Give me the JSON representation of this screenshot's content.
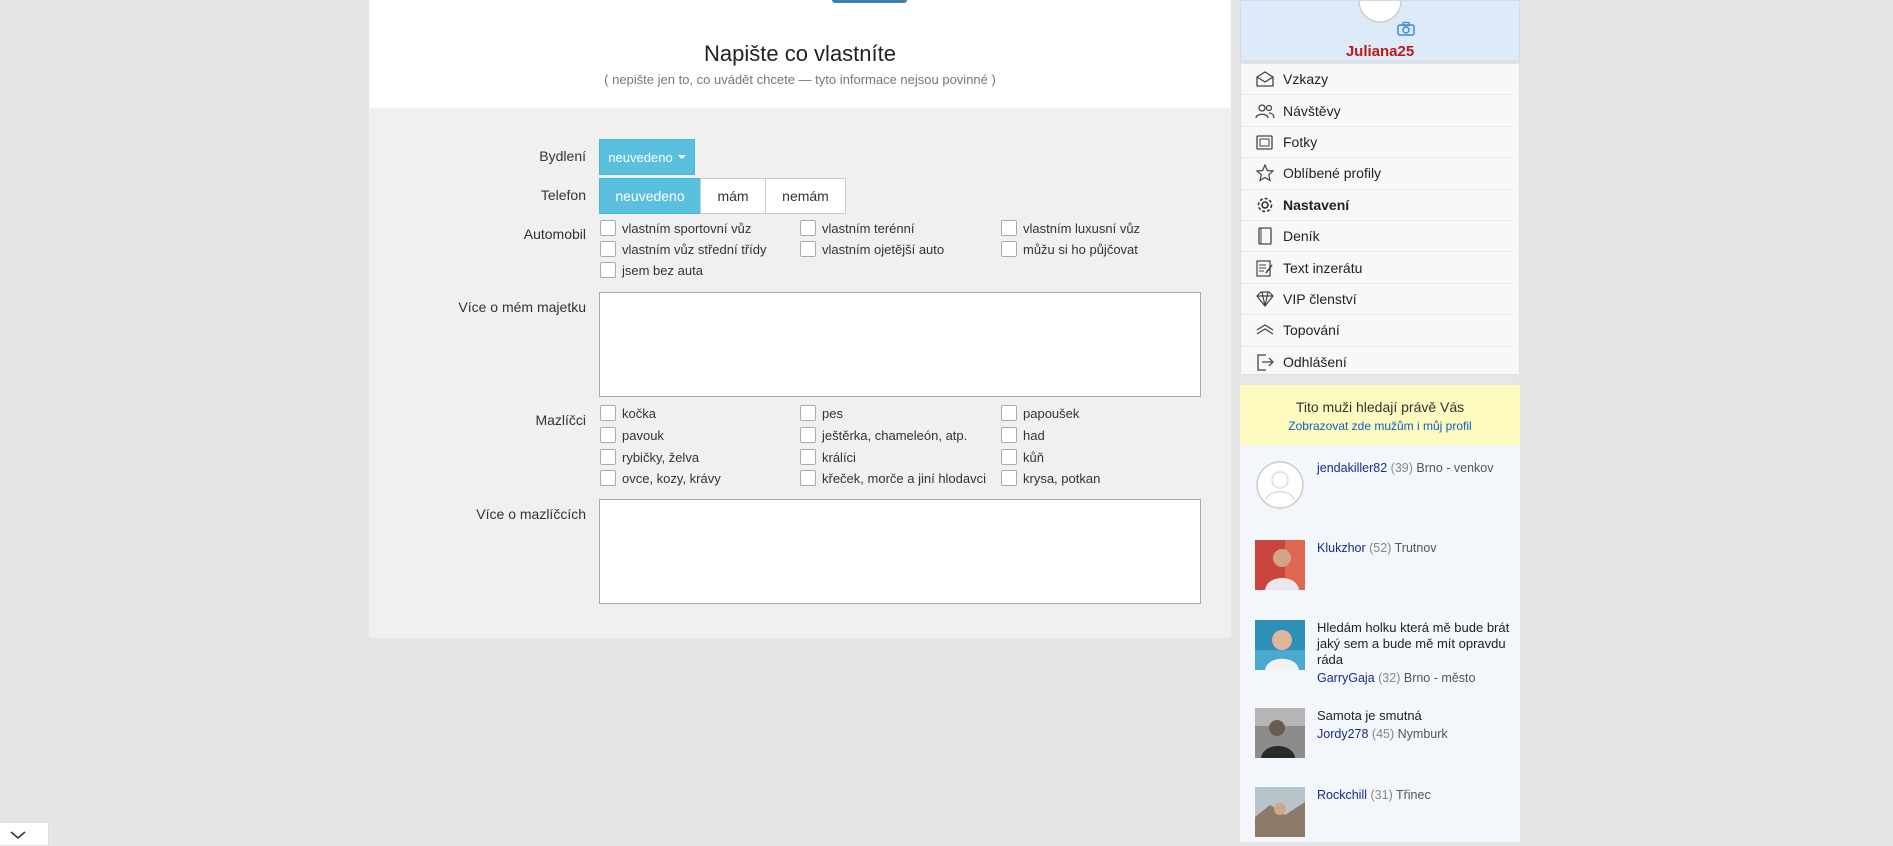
{
  "main": {
    "title": "Napište co vlastníte",
    "subtitle": "( nepište jen to, co uvádět chcete — tyto informace nejsou povinné )",
    "bydleni": {
      "label": "Bydlení",
      "value": "neuvedeno"
    },
    "telefon": {
      "label": "Telefon",
      "options": [
        "neuvedeno",
        "mám",
        "nemám"
      ]
    },
    "automobil": {
      "label": "Automobil",
      "options": [
        "vlastním sportovní vůz",
        "vlastním terénní",
        "vlastním luxusní vůz",
        "vlastním vůz střední třídy",
        "vlastním ojetější auto",
        "můžu si ho půjčovat",
        "jsem bez auta"
      ]
    },
    "majetek": {
      "label": "Více o mém majetku"
    },
    "mazlicci": {
      "label": "Mazlíčci",
      "options": [
        "kočka",
        "pes",
        "papoušek",
        "pavouk",
        "ještěrka, chameleón, atp.",
        "had",
        "rybičky, želva",
        "králíci",
        "kůň",
        "ovce, kozy, krávy",
        "křeček, morče a jiní hlodavci",
        "krysa, potkan"
      ]
    },
    "vice_mazlicci": {
      "label": "Více o mazlíčcích"
    }
  },
  "sidebar": {
    "username": "Juliana25",
    "menu": [
      "Vzkazy",
      "Návštěvy",
      "Fotky",
      "Oblíbené profily",
      "Nastavení",
      "Deník",
      "Text inzerátu",
      "VIP členství",
      "Topování",
      "Odhlášení"
    ],
    "promo": {
      "title": "Tito muži hledají právě Vás",
      "link": "Zobrazovat zde mužům i můj profil"
    },
    "people": [
      {
        "msg": "",
        "name": "jendakiller82",
        "age": "(39)",
        "loc": "Brno - venkov"
      },
      {
        "msg": "",
        "name": "Klukzhor",
        "age": "(52)",
        "loc": "Trutnov"
      },
      {
        "msg": "Hledám holku která mě bude brát jaký sem a bude mě mít opravdu ráda",
        "name": "GarryGaja",
        "age": "(32)",
        "loc": "Brno - město"
      },
      {
        "msg": "Samota je smutná",
        "name": "Jordy278",
        "age": "(45)",
        "loc": "Nymburk"
      },
      {
        "msg": "",
        "name": "Rockchill",
        "age": "(31)",
        "loc": "Třinec"
      }
    ]
  },
  "colors": {
    "accent": "#5bc0de",
    "username": "#c0171c",
    "link": "#1060c0",
    "promo_bg": "#fcfabe"
  }
}
